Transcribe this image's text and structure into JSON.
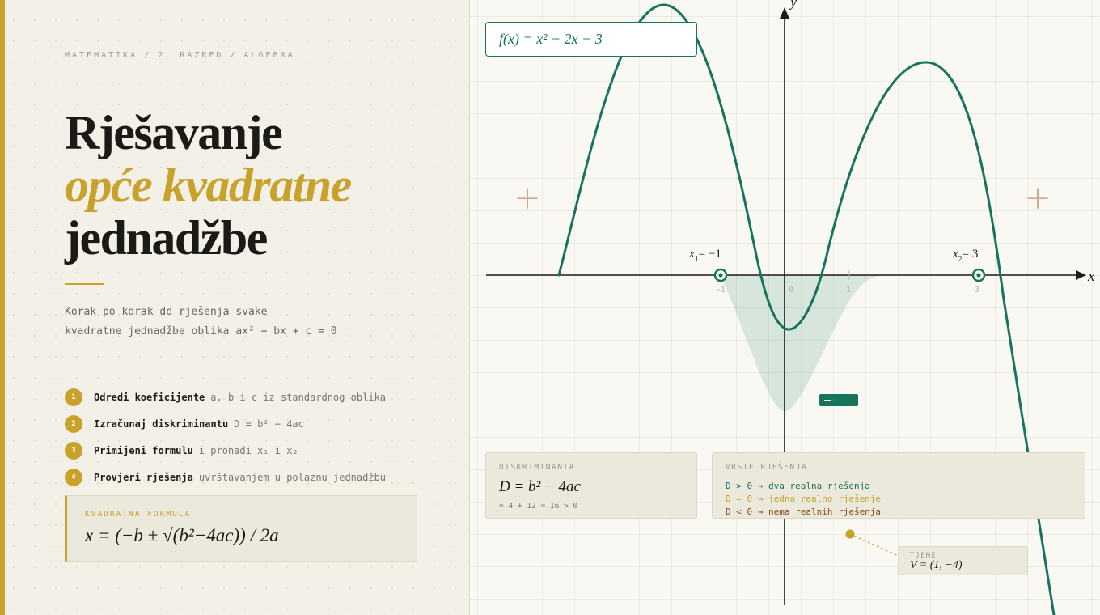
{
  "breadcrumb": {
    "subject": "MATEMATIKA",
    "grade": "2. RAZRED",
    "topic": "ALGEBRA",
    "separator": "/"
  },
  "hero": {
    "title_line1": "Rješavanje",
    "title_line2": "opće kvadratne",
    "title_line3": "jednadžbe",
    "subtitle_line1": "Korak po korak do rješenja svake",
    "subtitle_line2": "kvadratne jednadžbe oblika ax² + bx + c = 0"
  },
  "steps": [
    {
      "num": "1",
      "bold": "Odredi koeficijente",
      "rest": "a, b i c iz standardnog oblika"
    },
    {
      "num": "2",
      "bold": "Izračunaj diskriminantu",
      "rest": "D = b² − 4ac"
    },
    {
      "num": "3",
      "bold": "Primijeni formulu",
      "rest": "i pronađi x₁ i x₂"
    },
    {
      "num": "4",
      "bold": "Provjeri rješenja",
      "rest": "uvrštavanjem u polaznu jednadžbu"
    }
  ],
  "formula": {
    "label": "KVADRATNA FORMULA",
    "text": "x = (−b ± √(b²−4ac)) / 2a"
  },
  "graph": {
    "function_label": "f(x) = x² − 2x − 3",
    "axis_x": "x",
    "axis_y": "y",
    "tick_labels": [
      "−1",
      "0",
      "1",
      "3"
    ],
    "root1": {
      "prefix": "x",
      "sub": "1",
      "value": "= −1"
    },
    "root2": {
      "prefix": "x",
      "sub": "2",
      "value": "= 3"
    },
    "plus_marker": "+"
  },
  "discriminant_card": {
    "label": "DISKRIMINANTA",
    "formula": "D = b² − 4ac",
    "calc": "= 4 + 12 = 16 > 0"
  },
  "solution_types": {
    "label": "VRSTE RJEŠENJA",
    "items": [
      {
        "text": "D > 0 → dva realna rješenja",
        "color": "#16745a"
      },
      {
        "text": "D = 0 → jedno realno rješenje",
        "color": "#c9a22b"
      },
      {
        "text": "D < 0 → nema realnih rješenja",
        "color": "#8a4a1e"
      }
    ]
  },
  "vertex": {
    "label": "TJEME",
    "value": "V = (1, −4)"
  },
  "colors": {
    "accent_gold": "#c9a22b",
    "curve_green": "#16745a",
    "plus_marker": "#c9907a"
  }
}
